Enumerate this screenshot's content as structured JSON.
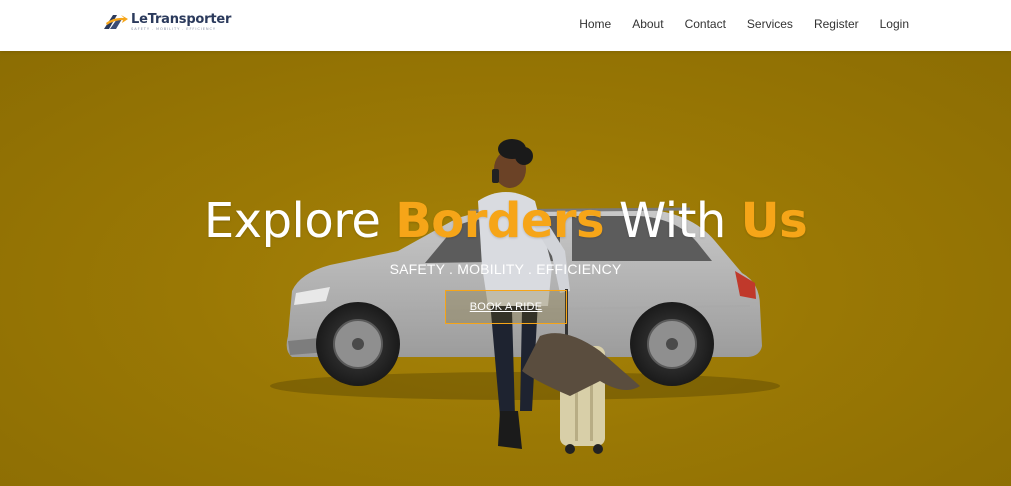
{
  "brand": {
    "name": "LeTransporter",
    "tagline": "SAFETY . MOBILITY . EFFICIENCY",
    "logo_icon": "road-arrow-logo",
    "colors": {
      "orange": "#f6a518",
      "navy": "#2b3a5c"
    }
  },
  "nav": {
    "items": [
      {
        "label": "Home"
      },
      {
        "label": "About"
      },
      {
        "label": "Contact"
      },
      {
        "label": "Services"
      },
      {
        "label": "Register"
      },
      {
        "label": "Login"
      }
    ]
  },
  "hero": {
    "title_part1": "Explore ",
    "title_accent1": "Borders",
    "title_part2": " With ",
    "title_accent2": "Us",
    "subtitle": "SAFETY . MOBILITY . EFFICIENCY",
    "cta_label": "BOOK A RIDE",
    "background_color": "#9a7805",
    "accent_color": "#f6a518"
  }
}
